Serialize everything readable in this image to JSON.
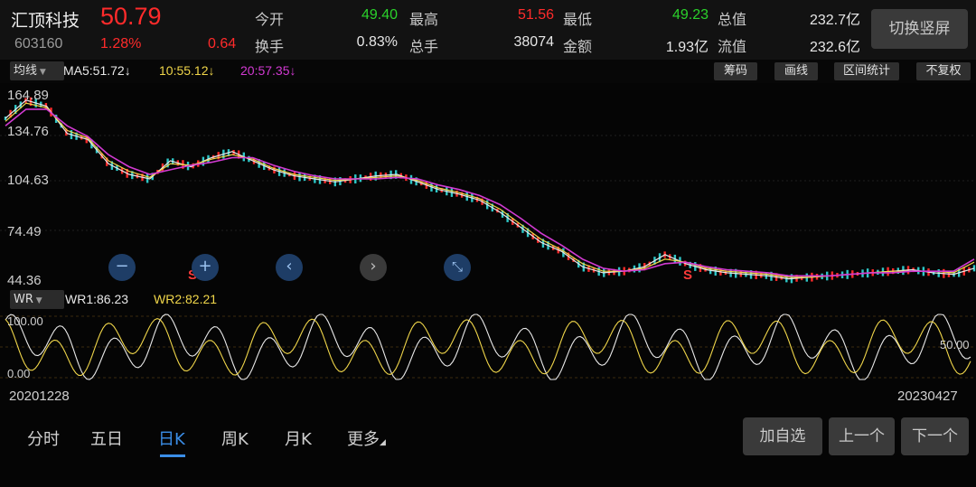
{
  "header": {
    "stock_name": "汇顶科技",
    "price": "50.79",
    "code": "603160",
    "change_pct": "1.28%",
    "change_val": "0.64",
    "open_label": "今开",
    "open_val": "49.40",
    "high_label": "最高",
    "high_val": "51.56",
    "low_label": "最低",
    "low_val": "49.23",
    "total_mv_label": "总值",
    "total_mv_val": "232.7亿",
    "turnover_label": "换手",
    "turnover_val": "0.83%",
    "volume_label": "总手",
    "volume_val": "38074",
    "amount_label": "金额",
    "amount_val": "1.93亿",
    "float_mv_label": "流值",
    "float_mv_val": "232.6亿",
    "switch_button": "切换竖屏"
  },
  "ma_bar": {
    "mode": "均线",
    "ma5": "MA5:51.72↓",
    "ma10": "10:55.12↓",
    "ma20": "20:57.35↓",
    "tools": [
      "筹码",
      "画线",
      "区间统计",
      "不复权"
    ]
  },
  "main_chart": {
    "y_labels": [
      "164.89",
      "134.76",
      "104.63",
      "74.49",
      "44.36"
    ],
    "signal_marks": [
      "S",
      "S"
    ],
    "controls": [
      "−",
      "+",
      "‹",
      "›",
      "⤡"
    ]
  },
  "indicator": {
    "name": "WR",
    "wr1": "WR1:86.23",
    "wr2": "WR2:82.21",
    "y_labels": [
      "100.00",
      "50.00",
      "0.00"
    ]
  },
  "dates": {
    "start": "20201228",
    "end": "20230427"
  },
  "tabs": [
    "分时",
    "五日",
    "日K",
    "周K",
    "月K",
    "更多"
  ],
  "active_tab": "日K",
  "actions": [
    "加自选",
    "上一个",
    "下一个"
  ],
  "colors": {
    "up": "#ff2b2b",
    "down": "#2bd12b",
    "ma5": "#e8e8e8",
    "ma10": "#f0d64a",
    "ma20": "#d23ad2",
    "accent": "#3b8ee8"
  },
  "chart_data": {
    "type": "line",
    "series": [
      {
        "name": "MA5",
        "values": [
          150,
          162,
          158,
          140,
          136,
          120,
          113,
          110,
          122,
          118,
          124,
          128,
          122,
          116,
          112,
          110,
          108,
          110,
          112,
          113,
          108,
          103,
          100,
          96,
          88,
          78,
          68,
          62,
          52,
          48,
          49,
          52,
          60,
          54,
          50,
          48,
          47,
          46,
          44,
          45,
          46,
          47,
          48,
          49,
          50,
          48,
          47,
          51
        ]
      },
      {
        "name": "10",
        "values": [
          148,
          160,
          157,
          142,
          137,
          122,
          115,
          111,
          120,
          119,
          123,
          126,
          123,
          117,
          113,
          111,
          109,
          110,
          111,
          112,
          109,
          104,
          101,
          97,
          90,
          80,
          70,
          63,
          54,
          49,
          49,
          51,
          57,
          55,
          51,
          49,
          48,
          47,
          45,
          45,
          46,
          47,
          48,
          49,
          49,
          49,
          48,
          55
        ]
      },
      {
        "name": "20",
        "values": [
          145,
          156,
          156,
          145,
          138,
          126,
          118,
          113,
          116,
          119,
          121,
          124,
          124,
          119,
          115,
          112,
          110,
          110,
          110,
          111,
          110,
          106,
          103,
          99,
          93,
          84,
          74,
          66,
          57,
          51,
          49,
          50,
          54,
          55,
          52,
          50,
          49,
          48,
          46,
          46,
          46,
          47,
          48,
          48,
          49,
          49,
          49,
          57
        ]
      }
    ],
    "ylim": [
      44.36,
      164.89
    ],
    "y_ticks": [
      164.89,
      134.76,
      104.63,
      74.49,
      44.36
    ],
    "x_range": [
      "20201228",
      "20230427"
    ]
  }
}
